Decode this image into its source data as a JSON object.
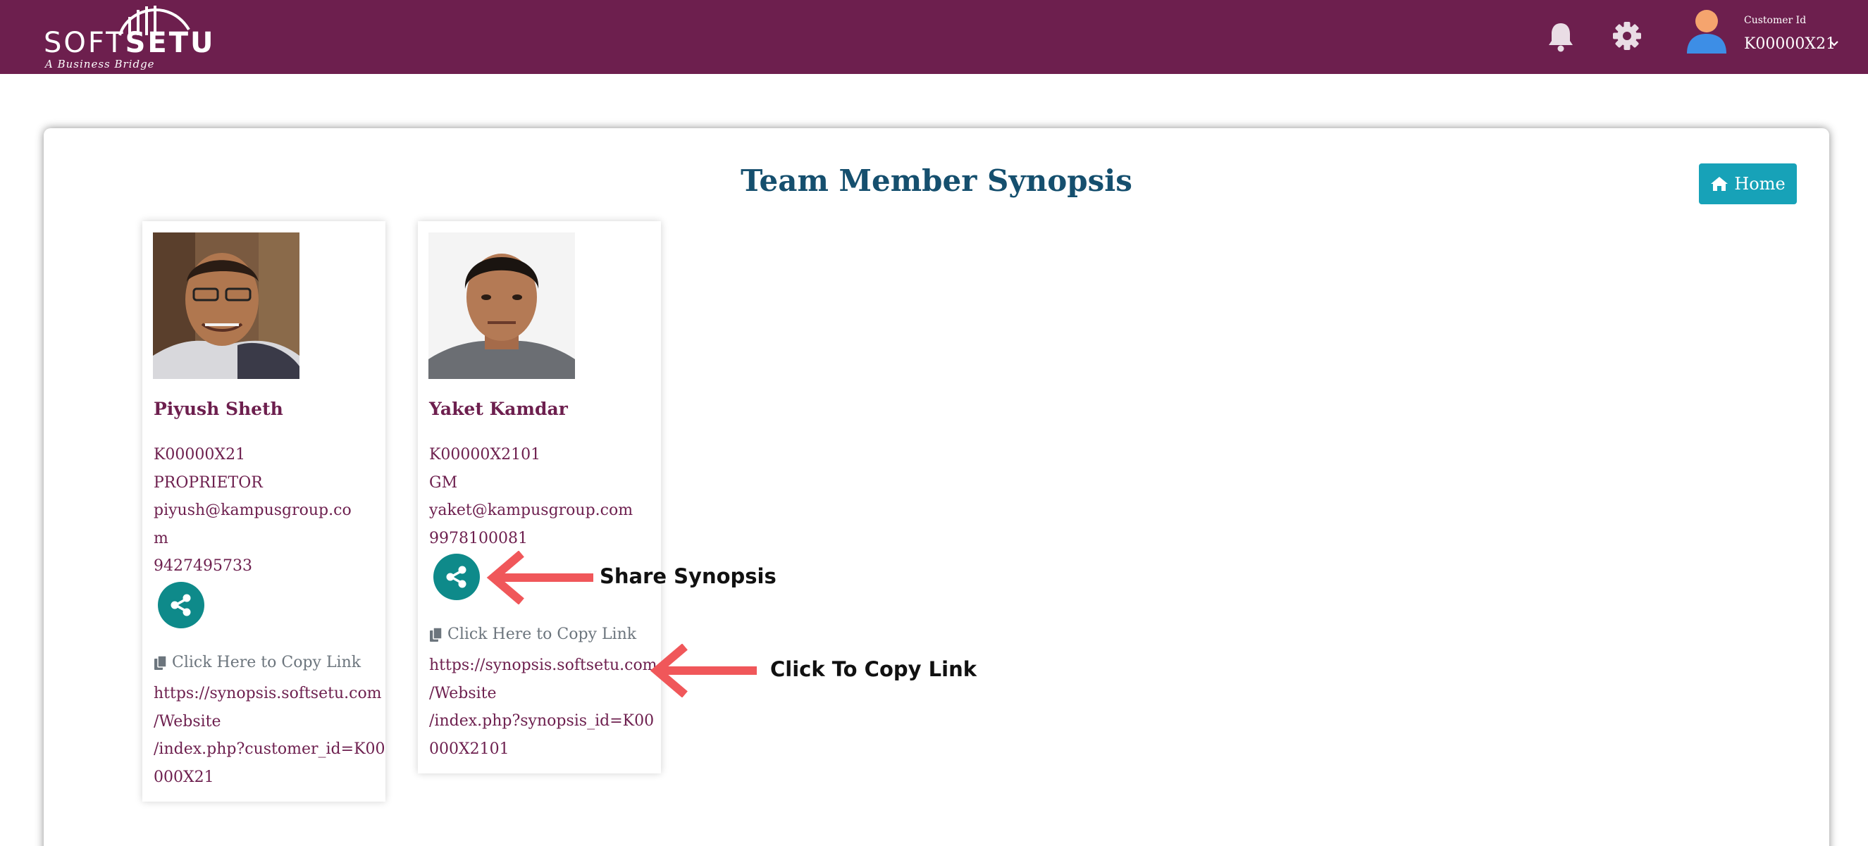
{
  "header": {
    "logo": {
      "word_light": "SOFT",
      "word_bold": "SETU",
      "tagline": "A Business Bridge"
    },
    "icons": [
      "bell-icon",
      "gear-icon",
      "user-avatar"
    ],
    "customer_label": "Customer Id",
    "customer_value": "K00000X21"
  },
  "page": {
    "title": "Team Member Synopsis",
    "home_label": "Home"
  },
  "members": [
    {
      "name": "Piyush Sheth",
      "id": "K00000X21",
      "role": "PROPRIETOR",
      "email_line1": "piyush@kampusgroup.co",
      "email_line2": "m",
      "phone": "9427495733",
      "copy_label": "Click Here to Copy Link",
      "link_lines": [
        "https://synopsis.softsetu.com",
        "/Website",
        "/index.php?customer_id=K00",
        "000X21"
      ]
    },
    {
      "name": "Yaket Kamdar",
      "id": "K00000X2101",
      "role": "GM",
      "email_line1": "yaket@kampusgroup.com",
      "phone": "9978100081",
      "copy_label": "Click Here to Copy Link",
      "link_lines": [
        "https://synopsis.softsetu.com",
        "/Website",
        "/index.php?synopsis_id=K00",
        "000X2101"
      ]
    }
  ],
  "annotations": {
    "share": "Share Synopsis",
    "copy": "Click To Copy Link"
  },
  "colors": {
    "brand": "#6d1f4e",
    "title": "#154f6e",
    "home_button": "#17a2b8",
    "share_button": "#0e8a8a",
    "annotation_arrow": "#f0575a"
  }
}
